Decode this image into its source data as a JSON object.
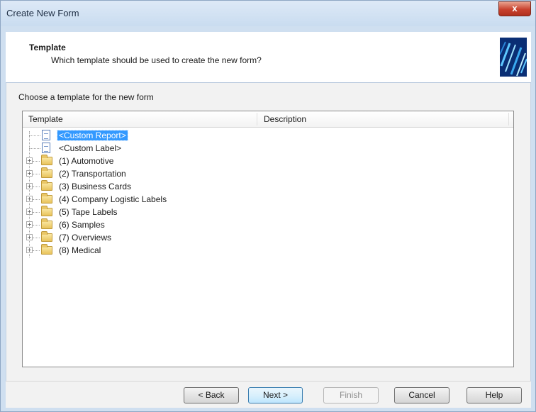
{
  "window": {
    "title": "Create New Form",
    "close_glyph": "x"
  },
  "header": {
    "title": "Template",
    "subtitle": "Which template should be used to create the new form?"
  },
  "body": {
    "choose_label": "Choose a template for the new form"
  },
  "tree": {
    "columns": {
      "template": "Template",
      "description": "Description"
    },
    "items": [
      {
        "label": "<Custom Report>",
        "icon": "document-icon",
        "expandable": false,
        "selected": true
      },
      {
        "label": "<Custom Label>",
        "icon": "document-icon",
        "expandable": false,
        "selected": false
      },
      {
        "label": "(1) Automotive",
        "icon": "folder-icon",
        "expandable": true,
        "selected": false
      },
      {
        "label": "(2) Transportation",
        "icon": "folder-icon",
        "expandable": true,
        "selected": false
      },
      {
        "label": "(3) Business Cards",
        "icon": "folder-icon",
        "expandable": true,
        "selected": false
      },
      {
        "label": "(4) Company Logistic Labels",
        "icon": "folder-icon",
        "expandable": true,
        "selected": false
      },
      {
        "label": "(5) Tape Labels",
        "icon": "folder-icon",
        "expandable": true,
        "selected": false
      },
      {
        "label": "(6) Samples",
        "icon": "folder-icon",
        "expandable": true,
        "selected": false
      },
      {
        "label": "(7) Overviews",
        "icon": "folder-icon",
        "expandable": true,
        "selected": false
      },
      {
        "label": "(8) Medical",
        "icon": "folder-icon",
        "expandable": true,
        "selected": false
      }
    ]
  },
  "buttons": {
    "back": "< Back",
    "next": "Next >",
    "finish": "Finish",
    "cancel": "Cancel",
    "help": "Help"
  },
  "colors": {
    "selection": "#3399ff",
    "title_bar": "#cfdff0",
    "header_art": "#0a2e74"
  }
}
